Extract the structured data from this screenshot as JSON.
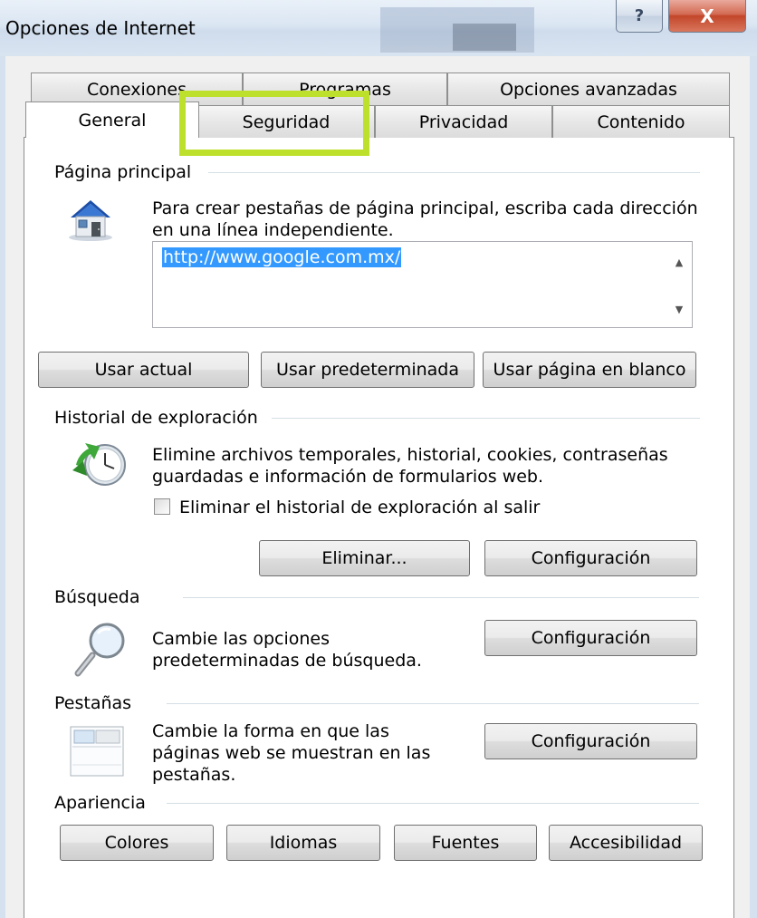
{
  "window": {
    "title": "Opciones de Internet",
    "help_glyph": "?",
    "close_glyph": "X"
  },
  "tabs": {
    "row_back": [
      {
        "label": "Conexiones"
      },
      {
        "label": "Programas"
      },
      {
        "label": "Opciones avanzadas"
      }
    ],
    "row_front": [
      {
        "label": "General",
        "selected": true
      },
      {
        "label": "Seguridad",
        "highlighted": true
      },
      {
        "label": "Privacidad"
      },
      {
        "label": "Contenido"
      }
    ]
  },
  "home_page": {
    "group_label": "Página principal",
    "icon": "house-icon",
    "description_line1": "Para crear pestañas de página principal, escriba cada dirección",
    "description_line2": "en una línea independiente.",
    "url_value": "http://www.google.com.mx/",
    "buttons": {
      "use_current": "Usar actual",
      "use_default": "Usar predeterminada",
      "use_blank": "Usar página en blanco"
    }
  },
  "history": {
    "group_label": "Historial de exploración",
    "icon": "history-clock-icon",
    "description_line1": "Elimine archivos temporales, historial, cookies, contraseñas",
    "description_line2": "guardadas e información de formularios web.",
    "checkbox_label": "Eliminar el historial de exploración al salir",
    "checkbox_checked": false,
    "buttons": {
      "delete": "Eliminar...",
      "settings": "Configuración"
    }
  },
  "search": {
    "group_label": "Búsqueda",
    "icon": "magnifier-icon",
    "description_line1": "Cambie las opciones",
    "description_line2": "predeterminadas de búsqueda.",
    "settings_button": "Configuración"
  },
  "tabs_section": {
    "group_label": "Pestañas",
    "icon": "tabs-window-icon",
    "description_line1": "Cambie la forma en que las",
    "description_line2": "páginas web se muestran en las",
    "description_line3": "pestañas.",
    "settings_button": "Configuración"
  },
  "appearance": {
    "group_label": "Apariencia",
    "buttons": {
      "colors": "Colores",
      "languages": "Idiomas",
      "fonts": "Fuentes",
      "accessibility": "Accesibilidad"
    }
  },
  "colors": {
    "highlight": "#bde02c",
    "selection": "#3399ff",
    "close_button": "#c2462a"
  }
}
